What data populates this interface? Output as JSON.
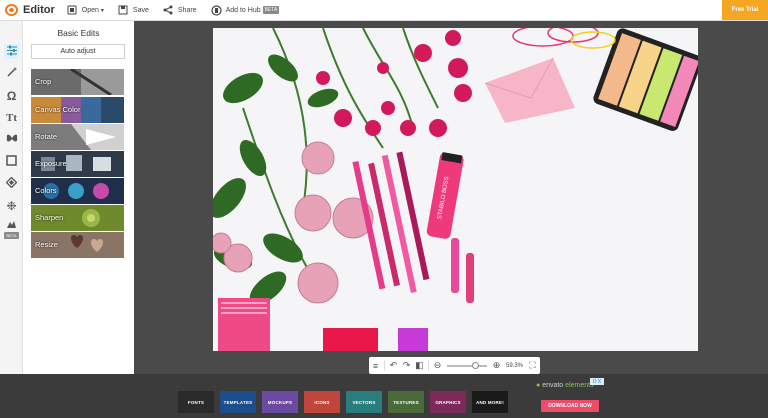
{
  "app": {
    "title": "Editor"
  },
  "toolbar": {
    "open_label": "Open",
    "save_label": "Save",
    "share_label": "Share",
    "add_to_hub_label": "Add to Hub",
    "beta_label": "BETA",
    "free_trial_label": "Free Trial"
  },
  "tools": {
    "beta_label": "BETA",
    "items": [
      "sliders-icon",
      "magic-wand-icon",
      "sticker-icon",
      "text-icon",
      "butterfly-icon",
      "frame-icon",
      "texture-icon",
      "snowflake-icon",
      "design-icon"
    ]
  },
  "panel": {
    "title": "Basic Edits",
    "auto_adjust": "Auto adjust",
    "items": [
      {
        "label": "Crop",
        "color": "#6b6b6b"
      },
      {
        "label": "Canvas Color",
        "color": "#c98a3a"
      },
      {
        "label": "Rotate",
        "color": "#7c7c7c"
      },
      {
        "label": "Exposure",
        "color": "#2f3b49"
      },
      {
        "label": "Colors",
        "color": "#2a6fa8"
      },
      {
        "label": "Sharpen",
        "color": "#6f8a2c"
      },
      {
        "label": "Resize",
        "color": "#8a7466"
      }
    ]
  },
  "zoom": {
    "value": "59.3%"
  },
  "ad": {
    "categories": [
      {
        "label": "FONTS",
        "color": "#2b2b2b"
      },
      {
        "label": "TEMPLATES",
        "color": "#1e4d8c"
      },
      {
        "label": "MOCKUPS",
        "color": "#6a4aa0"
      },
      {
        "label": "ICONS",
        "color": "#c0453b"
      },
      {
        "label": "VECTORS",
        "color": "#2a7d7d"
      },
      {
        "label": "TEXTURES",
        "color": "#4a6a3a"
      },
      {
        "label": "GRAPHICS",
        "color": "#7d2a5a"
      },
      {
        "label": "AND MORE!",
        "color": "#1a1a1a"
      }
    ],
    "brand_prefix": "envato",
    "brand_suffix": "elements",
    "badge": "D X",
    "download_label": "DOWNLOAD NOW"
  }
}
